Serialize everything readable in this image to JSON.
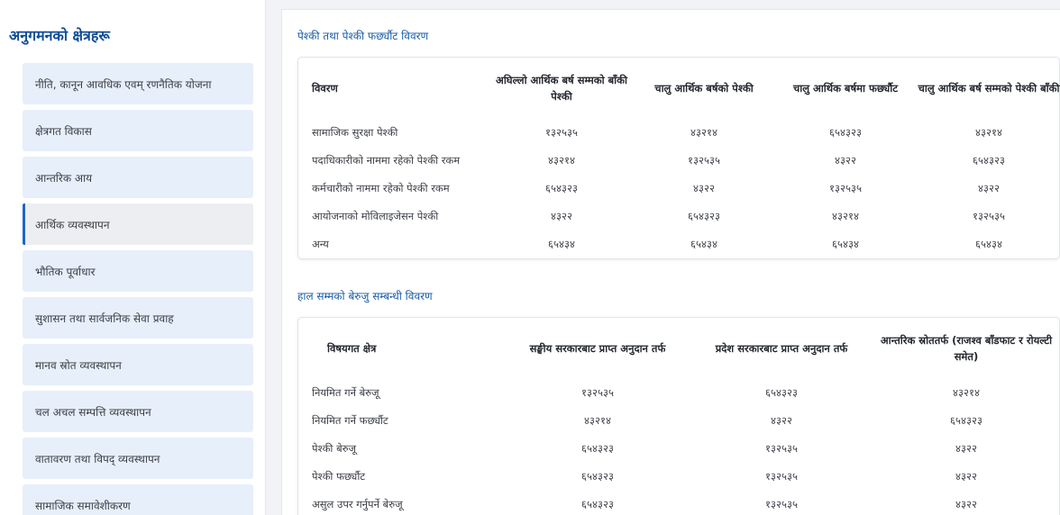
{
  "sidebar": {
    "title": "अनुगमनको क्षेत्रहरू",
    "items": [
      {
        "label": "नीति, कानून आवधिक एवम् रणनैतिक योजना"
      },
      {
        "label": "क्षेत्रगत विकास"
      },
      {
        "label": "आन्तरिक आय"
      },
      {
        "label": "आर्थिक व्यवस्थापन",
        "active": true
      },
      {
        "label": "भौतिक पूर्वाधार"
      },
      {
        "label": "सुशासन तथा सार्वजनिक सेवा प्रवाह"
      },
      {
        "label": "मानव स्रोत व्यवस्थापन"
      },
      {
        "label": "चल अचल सम्पत्ति व्यवस्थापन"
      },
      {
        "label": "वातावरण तथा विपद् व्यवस्थापन"
      },
      {
        "label": "सामाजिक समावेशीकरण"
      }
    ]
  },
  "advance": {
    "title": "पेश्की तथा पेश्की फर्छ्यौट विवरण",
    "headers": [
      "विवरण",
      "अघिल्लो आर्थिक बर्ष सम्मको बाँकी पेश्की",
      "चालु आर्थिक बर्षको पेश्की",
      "चालु आर्थिक बर्षमा फर्छ्यौट",
      "चालु आर्थिक बर्ष सम्मको पेश्की बाँकी"
    ],
    "rows": [
      [
        "सामाजिक सुरक्षा पेश्की",
        "१३२५३५",
        "४३२१४",
        "६५४३२३",
        "४३२१४"
      ],
      [
        "पदाधिकारीको नाममा रहेको पेश्की रकम",
        "४३२१४",
        "१३२५३५",
        "४३२२",
        "६५४३२३"
      ],
      [
        "कर्मचारीको नाममा रहेको पेश्की रकम",
        "६५४३२३",
        "४३२२",
        "१३२५३५",
        "४३२२"
      ],
      [
        "आयोजनाको मोविलाइजेसन पेश्की",
        "४३२२",
        "६५४३२३",
        "४३२१४",
        "१३२५३५"
      ],
      [
        "अन्य",
        "६५४३४",
        "६५४३४",
        "६५४३४",
        "६५४३४"
      ]
    ]
  },
  "arrears": {
    "title": "हाल सम्मको बेरुजु सम्बन्धी विवरण",
    "headers": [
      "विषयगत क्षेत्र",
      "सङ्घीय सरकारबाट प्राप्त अनुदान तर्फ",
      "प्रदेश सरकारबाट प्राप्त अनुदान तर्फ",
      "आन्तरिक स्रोततर्फ (राजश्व बाँडफाट र रोयल्टी समेत)"
    ],
    "rows": [
      [
        "नियमित गर्ने बेरुजू",
        "१३२५३५",
        "६५४३२३",
        "४३२१४"
      ],
      [
        "नियमित गर्ने फर्छ्यौट",
        "४३२१४",
        "४३२२",
        "६५४३२३"
      ],
      [
        "पेश्की बेरुजू",
        "६५४३२३",
        "१३२५३५",
        "४३२२"
      ],
      [
        "पेश्की फर्छ्यौट",
        "६५४३२३",
        "१३२५३५",
        "४३२२"
      ],
      [
        "असुल उपर गर्नुपर्ने बेरुजू",
        "६५४३२३",
        "१३२५३५",
        "४३२२"
      ]
    ]
  }
}
